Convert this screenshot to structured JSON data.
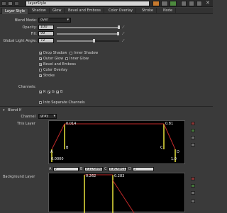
{
  "titlebar": {
    "node_name": "layerStyle"
  },
  "tabs": [
    {
      "label": "Layer Style",
      "active": true
    },
    {
      "label": "Shadow",
      "active": false
    },
    {
      "label": "Glow",
      "active": false
    },
    {
      "label": "Bevel and Emboss",
      "active": false
    },
    {
      "label": "Color Overlay",
      "active": false
    },
    {
      "label": "Stroke",
      "active": false
    },
    {
      "label": "Node",
      "active": false
    }
  ],
  "params": {
    "blend_mode": {
      "label": "Blend Mode:",
      "value": "over"
    },
    "opacity": {
      "label": "Opacity:",
      "value": "100",
      "fraction": 1.0
    },
    "fill": {
      "label": "Fill:",
      "value": "99",
      "fraction": 0.99
    },
    "light_angle": {
      "label": "Global Light Angle:",
      "value": "72",
      "fraction": 0.6
    }
  },
  "effects": {
    "drop_shadow": {
      "label": "Drop Shadow",
      "checked": true
    },
    "inner_shadow": {
      "label": "Inner Shadow",
      "checked": false
    },
    "outer_glow": {
      "label": "Outer Glow",
      "checked": true
    },
    "inner_glow": {
      "label": "Inner Glow",
      "checked": false
    },
    "bevel": {
      "label": "Bevel and Emboss",
      "checked": true
    },
    "color_overlay": {
      "label": "Color Overlay",
      "checked": false
    },
    "stroke": {
      "label": "Stroke",
      "checked": true
    }
  },
  "channels": {
    "label": "Channels:",
    "r": "R",
    "g": "G",
    "b": "B",
    "separate_label": "Into Separate Channels"
  },
  "blend_if": {
    "title": "Blend If",
    "channel_label": "Channel",
    "channel_value": "gray",
    "this_layer_label": "This Layer",
    "background_layer_label": "Background Layer",
    "graph1": {
      "tl": "0.014",
      "tr": "0.81",
      "a": "A",
      "b": "B",
      "c": "C",
      "d": "D",
      "bl": "0.0000",
      "br": "1.0"
    },
    "num_row": {
      "a_label": "A",
      "a_val": "0",
      "b_label": "B",
      "b_val": "0.317594937",
      "c_label": "C",
      "c_val": "0.807895173",
      "d_label": "D",
      "d_val": "1"
    },
    "graph2": {
      "tl": "0.262",
      "tr": "0.283"
    }
  },
  "colors": {
    "accent_yellow": "#e8e23c",
    "accent_red": "#c42a2a"
  }
}
